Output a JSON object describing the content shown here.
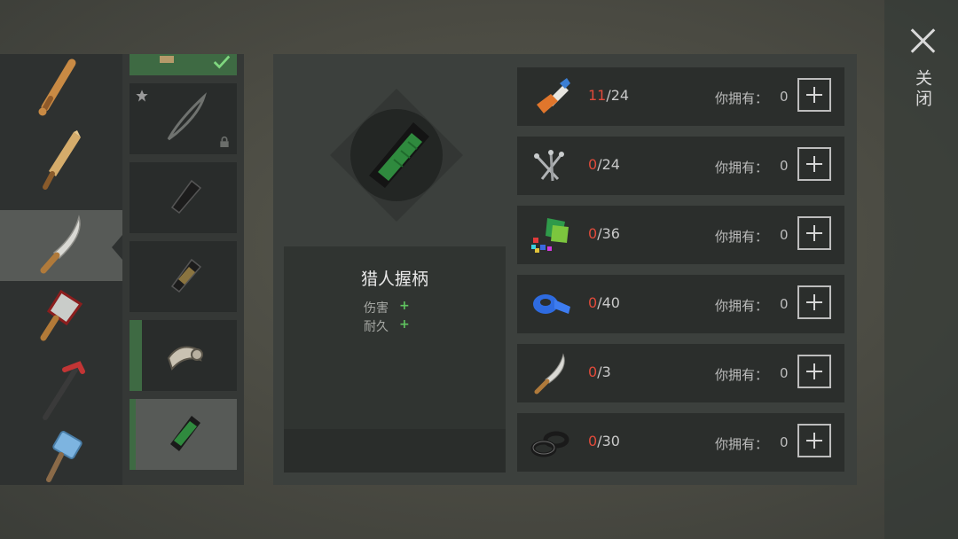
{
  "weapons": [
    {
      "name": "baseball-bat-icon",
      "top": 0
    },
    {
      "name": "plank-icon",
      "top": 0
    },
    {
      "name": "machete-icon",
      "top": 0
    },
    {
      "name": "cleaver-icon",
      "top": 0
    },
    {
      "name": "crowbar-icon",
      "top": 0
    },
    {
      "name": "hammer-icon",
      "top": 0
    }
  ],
  "parts": [
    {
      "icon": "spike-part-icon",
      "status": "completed"
    },
    {
      "icon": "blade-tip-icon",
      "status": "locked",
      "starred": true
    },
    {
      "icon": "black-handle-icon",
      "status": "available"
    },
    {
      "icon": "wrapped-handle-icon",
      "status": "available"
    },
    {
      "icon": "guard-handle-icon",
      "status": "installed"
    },
    {
      "icon": "hunter-grip-icon",
      "status": "selected"
    }
  ],
  "detail": {
    "name": "猎人握柄",
    "stats": [
      {
        "label": "伤害",
        "value": "+"
      },
      {
        "label": "耐久",
        "value": "+"
      }
    ]
  },
  "materials": [
    {
      "icon": "glue-icon",
      "have": "11",
      "need": "/24",
      "own_label": "你拥有：",
      "own": "0"
    },
    {
      "icon": "nails-icon",
      "have": "0",
      "need": "/24",
      "own_label": "你拥有：",
      "own": "0"
    },
    {
      "icon": "plastic-scraps-icon",
      "have": "0",
      "need": "/36",
      "own_label": "你拥有：",
      "own": "0"
    },
    {
      "icon": "tape-icon",
      "have": "0",
      "need": "/40",
      "own_label": "你拥有：",
      "own": "0"
    },
    {
      "icon": "machete-icon",
      "have": "0",
      "need": "/3",
      "own_label": "你拥有：",
      "own": "0"
    },
    {
      "icon": "washers-icon",
      "have": "0",
      "need": "/30",
      "own_label": "你拥有：",
      "own": "0"
    }
  ],
  "close_label": "关闭",
  "colors": {
    "shortage": "#e04a3a",
    "bonus": "#5fc35f",
    "installed": "#3e6a43"
  }
}
